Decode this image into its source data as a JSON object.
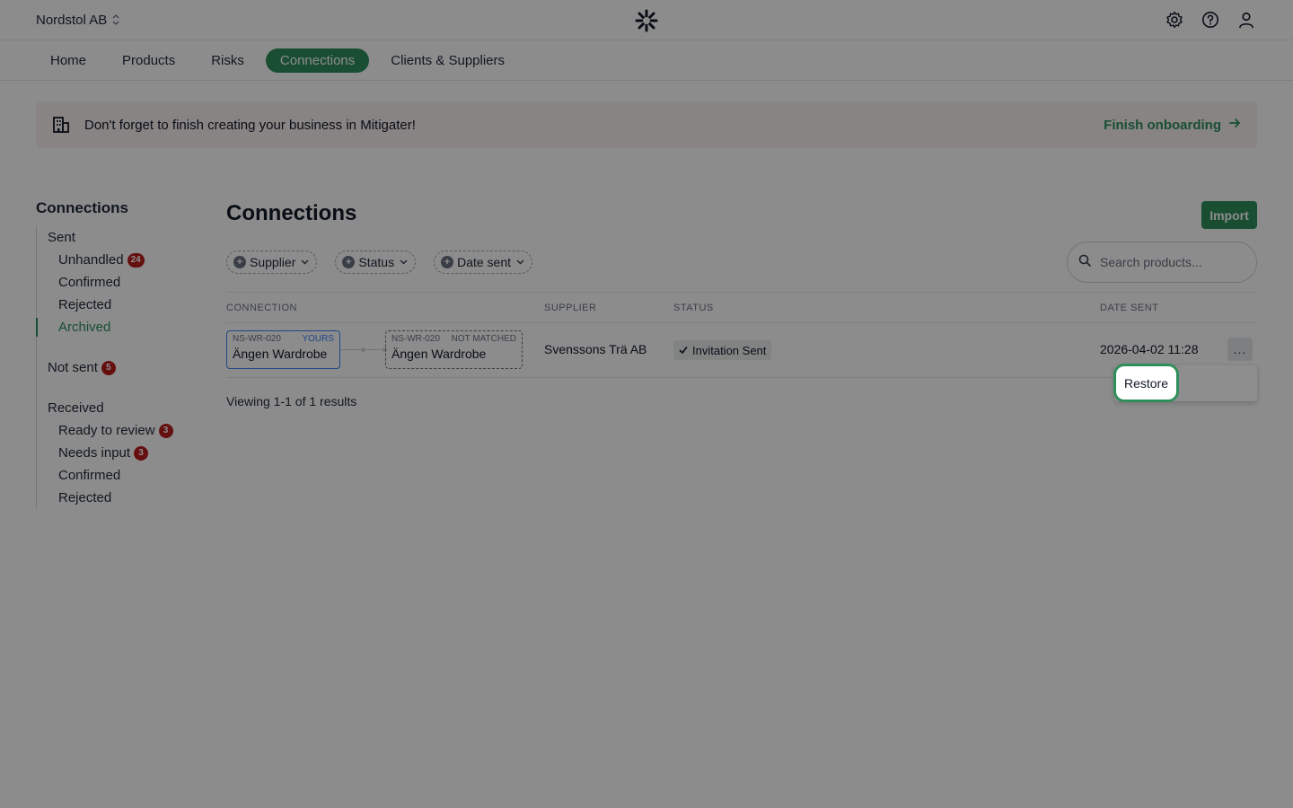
{
  "topbar": {
    "org_name": "Nordstol AB"
  },
  "nav": {
    "items": [
      "Home",
      "Products",
      "Risks",
      "Connections",
      "Clients & Suppliers"
    ],
    "active": "Connections"
  },
  "banner": {
    "text": "Don't forget to finish creating your business in Mitigater!",
    "link": "Finish onboarding"
  },
  "sidebar": {
    "title": "Connections",
    "sent_label": "Sent",
    "sent_items": [
      {
        "label": "Unhandled",
        "badge": "24"
      },
      {
        "label": "Confirmed"
      },
      {
        "label": "Rejected"
      },
      {
        "label": "Archived",
        "active": true
      }
    ],
    "not_sent_label": "Not sent",
    "not_sent_badge": "5",
    "received_label": "Received",
    "received_items": [
      {
        "label": "Ready to review",
        "badge": "3"
      },
      {
        "label": "Needs input",
        "badge": "3"
      },
      {
        "label": "Confirmed"
      },
      {
        "label": "Rejected"
      }
    ]
  },
  "main": {
    "title": "Connections",
    "import_label": "Import",
    "filters": [
      "Supplier",
      "Status",
      "Date sent"
    ],
    "search_placeholder": "Search products...",
    "columns": {
      "connection": "CONNECTION",
      "supplier": "SUPPLIER",
      "status": "STATUS",
      "date_sent": "DATE SENT"
    },
    "rows": [
      {
        "yours_code": "NS-WR-020",
        "yours_tag": "YOURS",
        "yours_name": "Ängen Wardrobe",
        "theirs_code": "NS-WR-020",
        "theirs_tag": "NOT MATCHED",
        "theirs_name": "Ängen Wardrobe",
        "supplier": "Svenssons Trä AB",
        "status": "Invitation Sent",
        "date_sent": "2026-04-02 11:28",
        "more": "..."
      }
    ],
    "viewing": "Viewing 1-1 of 1 results"
  },
  "menu": {
    "restore_label": "Restore"
  },
  "colors": {
    "accent": "#2f8f5b",
    "badge": "#b91c1c",
    "yours_blue": "#3b82f6"
  }
}
